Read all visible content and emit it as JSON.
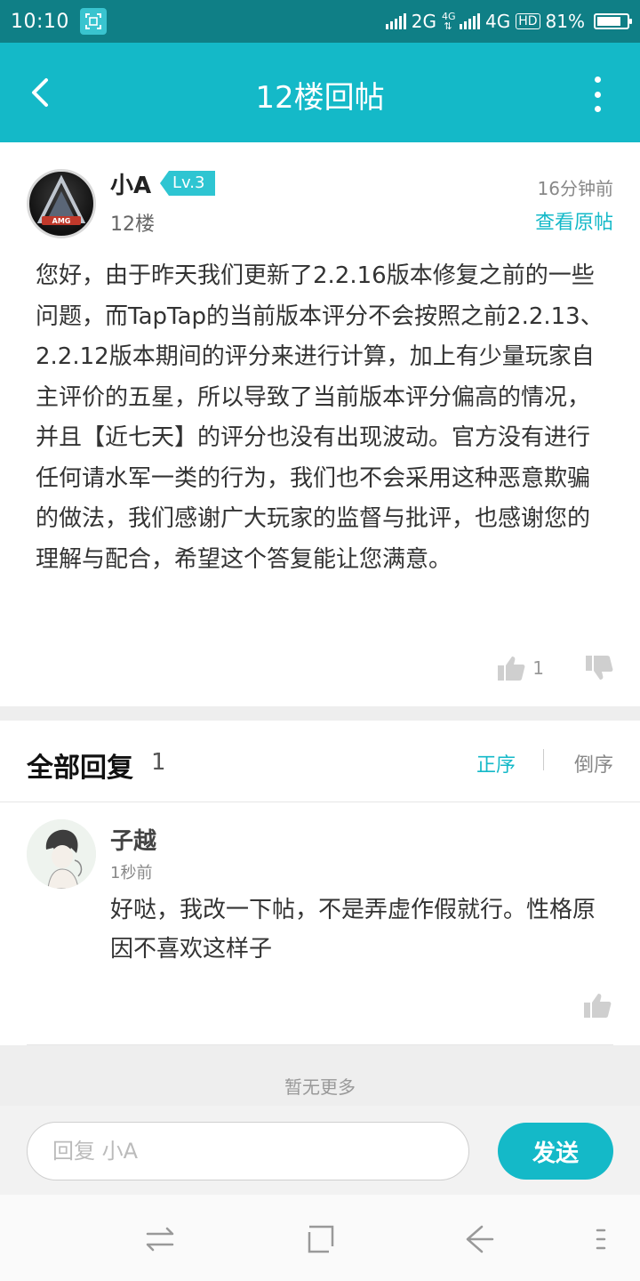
{
  "status_bar": {
    "time": "10:10",
    "network1": "2G",
    "network2": "4G",
    "hd": "HD",
    "battery": "81%",
    "battery_level": 0.81
  },
  "app_bar": {
    "title": "12楼回帖",
    "back_icon": "chevron-left-icon",
    "more_icon": "more-vertical-icon"
  },
  "post": {
    "author": "小A",
    "level": "Lv.3",
    "floor": "12楼",
    "time": "16分钟前",
    "view_original": "查看原帖",
    "body": "您好，由于昨天我们更新了2.2.16版本修复之前的一些问题，而TapTap的当前版本评分不会按照之前2.2.13、2.2.12版本期间的评分来进行计算，加上有少量玩家自主评价的五星，所以导致了当前版本评分偏高的情况，并且【近七天】的评分也没有出现波动。官方没有进行任何请水军一类的行为，我们也不会采用这种恶意欺骗的做法，我们感谢广大玩家的监督与批评，也感谢您的理解与配合，希望这个答复能让您满意。",
    "like_count": "1",
    "avatar_text": "AMG"
  },
  "replies": {
    "title": "全部回复",
    "count": "1",
    "sort_asc": "正序",
    "sort_desc": "倒序",
    "items": [
      {
        "author": "子越",
        "time": "1秒前",
        "body": "好哒，我改一下帖，不是弄虚作假就行。性格原因不喜欢这样子"
      }
    ],
    "no_more": "暂无更多"
  },
  "composer": {
    "placeholder": "回复 小A",
    "send_label": "发送"
  },
  "colors": {
    "accent": "#14b9c8",
    "status_bar": "#0f7f86"
  }
}
